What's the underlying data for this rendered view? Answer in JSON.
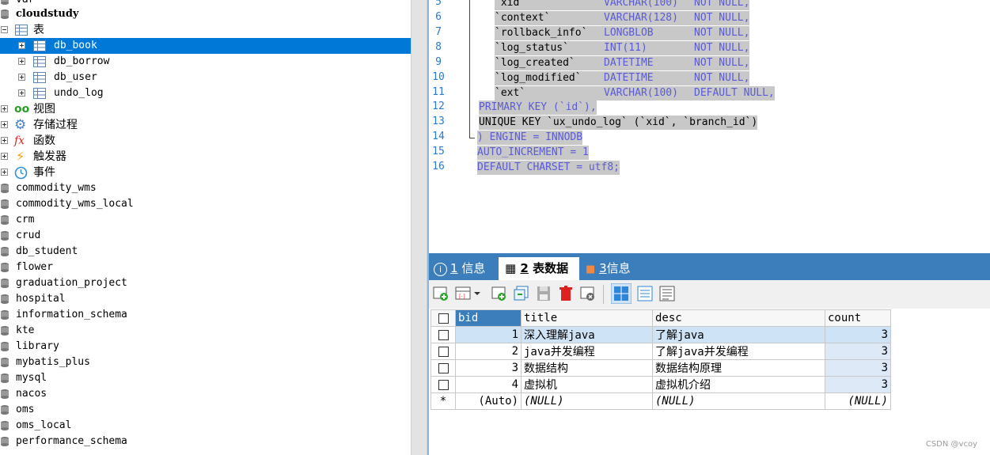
{
  "tree": {
    "top_partial": "var",
    "db_current": "cloudstudy",
    "folder_tables": "表",
    "tables": [
      "db_book",
      "db_borrow",
      "db_user",
      "undo_log"
    ],
    "folder_views": "视图",
    "folder_procedures": "存储过程",
    "folder_functions": "函数",
    "folder_triggers": "触发器",
    "folder_events": "事件",
    "databases": [
      "commodity_wms",
      "commodity_wms_local",
      "crm",
      "crud",
      "db_student",
      "flower",
      "graduation_project",
      "hospital",
      "information_schema",
      "kte",
      "library",
      "mybatis_plus",
      "mysql",
      "nacos",
      "oms",
      "oms_local",
      "performance_schema"
    ]
  },
  "editor": {
    "lines": [
      {
        "n": "5",
        "col": "`xid`",
        "type": "VARCHAR(100)",
        "rest": "NOT NULL,"
      },
      {
        "n": "6",
        "col": "`context`",
        "type": "VARCHAR(128)",
        "rest": "NOT NULL,"
      },
      {
        "n": "7",
        "col": "`rollback_info`",
        "type": "LONGBLOB",
        "rest": "NOT NULL,"
      },
      {
        "n": "8",
        "col": "`log_status`",
        "type": "INT(11)",
        "rest": "NOT NULL,"
      },
      {
        "n": "9",
        "col": "`log_created`",
        "type": "DATETIME",
        "rest": "NOT NULL,"
      },
      {
        "n": "10",
        "col": "`log_modified`",
        "type": "DATETIME",
        "rest": "NOT NULL,"
      },
      {
        "n": "11",
        "col": "`ext`",
        "type": "VARCHAR(100)",
        "rest": "DEFAULT NULL,"
      }
    ],
    "line12_n": "12",
    "line12": "PRIMARY KEY (`id`),",
    "line13_n": "13",
    "line13": "UNIQUE KEY `ux_undo_log` (`xid`, `branch_id`)",
    "line14_n": "14",
    "line14": ") ENGINE = INNODB",
    "line15_n": "15",
    "line15": "AUTO_INCREMENT = 1",
    "line16_n": "16",
    "line16": "DEFAULT CHARSET = utf8;"
  },
  "result_tabs": [
    {
      "num": "1",
      "label": "信息"
    },
    {
      "num": "2",
      "label": "表数据"
    },
    {
      "num": "3",
      "label": "信息"
    }
  ],
  "grid": {
    "columns": [
      "bid",
      "title",
      "desc",
      "count"
    ],
    "rows": [
      {
        "bid": "1",
        "title": "深入理解java",
        "desc": "了解java",
        "count": "3"
      },
      {
        "bid": "2",
        "title": "java并发编程",
        "desc": "了解java并发编程",
        "count": "3"
      },
      {
        "bid": "3",
        "title": "数据结构",
        "desc": "数据结构原理",
        "count": "3"
      },
      {
        "bid": "4",
        "title": "虚拟机",
        "desc": "虚拟机介绍",
        "count": "3"
      }
    ],
    "new_row": {
      "marker": "*",
      "bid": "(Auto)",
      "title": "(NULL)",
      "desc": "(NULL)",
      "count": "(NULL)"
    }
  },
  "watermark": "CSDN @vcoy",
  "colors": {
    "accent": "#3c7ebc",
    "selection": "#0078d7",
    "keyword": "#5a5ad8"
  }
}
